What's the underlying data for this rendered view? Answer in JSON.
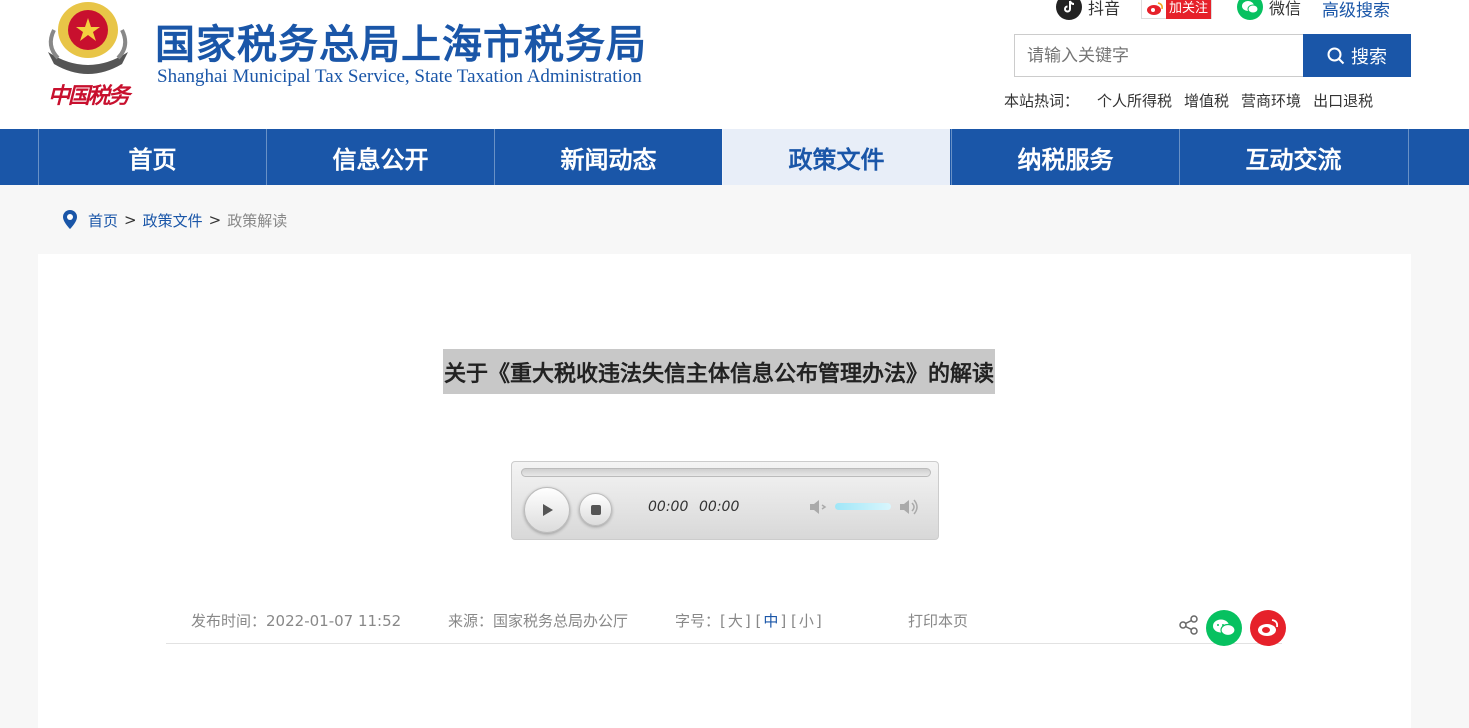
{
  "header": {
    "title": "国家税务总局上海市税务局",
    "subtitle": "Shanghai Municipal Tax Service, State Taxation Administration",
    "seal_text": "中国税务",
    "social": {
      "douyin": "抖音",
      "weibo_follow": "加关注",
      "wechat": "微信"
    },
    "advanced_search": "高级搜索",
    "search_placeholder": "请输入关键字",
    "search_button": "搜索",
    "hot_label": "本站热词：",
    "hot_words": [
      "个人所得税",
      "增值税",
      "营商环境",
      "出口退税"
    ]
  },
  "nav": {
    "items": [
      "首页",
      "信息公开",
      "新闻动态",
      "政策文件",
      "纳税服务",
      "互动交流"
    ],
    "active_index": 3
  },
  "breadcrumb": {
    "home": "首页",
    "section": "政策文件",
    "sep": ">",
    "current": "政策解读"
  },
  "article": {
    "title": "关于《重大税收违法失信主体信息公布管理办法》的解读",
    "player": {
      "current_time": "00:00",
      "duration": "00:00",
      "volume": 0.8
    },
    "meta": {
      "publish_label": "发布时间：",
      "publish_time": "2022-01-07 11:52",
      "source_label": "来源：",
      "source": "国家税务总局办公厅",
      "font_label": "字号：",
      "font_large": "大",
      "font_medium": "中",
      "font_small": "小",
      "print": "打印本页"
    }
  },
  "colors": {
    "brand_blue": "#1a56a8",
    "wechat_green": "#07c160",
    "weibo_red": "#e6212a"
  }
}
